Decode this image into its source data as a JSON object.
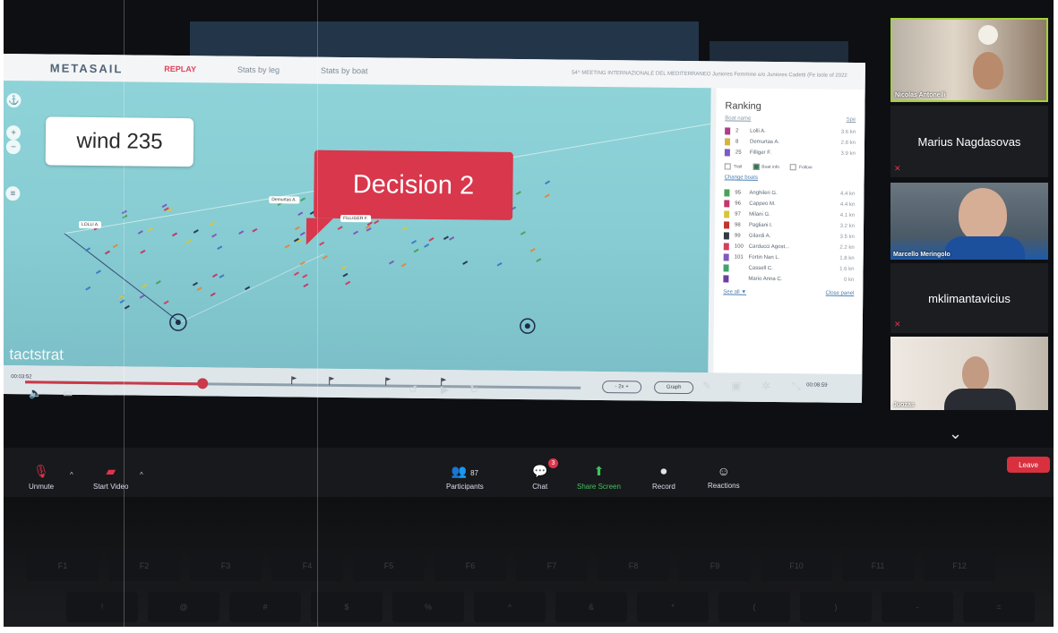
{
  "app": {
    "logo": "METASAIL",
    "tabs": [
      "REPLAY",
      "Stats by leg",
      "Stats by boat"
    ],
    "active_tab": "REPLAY",
    "event_title": "54^ MEETING INTERNAZIONALE DEL MEDITERRANEO Juniores Femmine e/o Juniores Cadetti (Fe isole of 2022"
  },
  "map": {
    "wind_label": "wind 235",
    "callout": "Decision 2",
    "watermark": "tactstrat",
    "boat_tags": [
      "LOLLI A.",
      "Demurtas A.",
      "FILLIGER F."
    ]
  },
  "ranking": {
    "title": "Ranking",
    "header_left": "Boat name",
    "header_right": "Spe",
    "top": [
      {
        "pos": "2",
        "name": "Lolli A.",
        "speed": "3.6 kn",
        "color": "#b03a8c"
      },
      {
        "pos": "8",
        "name": "Demurtas A.",
        "speed": "2.8 kn",
        "color": "#d9b23c"
      },
      {
        "pos": "25",
        "name": "Filliger F.",
        "speed": "3.9 kn",
        "color": "#7a5cc4"
      }
    ],
    "checks": [
      {
        "label": "Trail",
        "on": false
      },
      {
        "label": "Boat info",
        "on": true
      },
      {
        "label": "Follow",
        "on": false
      }
    ],
    "change_link": "Change boats",
    "rest": [
      {
        "pos": "95",
        "name": "Anghileri G.",
        "speed": "4.4 kn",
        "color": "#4aa35a"
      },
      {
        "pos": "96",
        "name": "Cappeo M.",
        "speed": "4.4 kn",
        "color": "#c0396b"
      },
      {
        "pos": "97",
        "name": "Milani G.",
        "speed": "4.1 kn",
        "color": "#d7c53e"
      },
      {
        "pos": "98",
        "name": "Pagliani I.",
        "speed": "3.2 kn",
        "color": "#c2352f"
      },
      {
        "pos": "99",
        "name": "Gilardi A.",
        "speed": "3.5 kn",
        "color": "#333a44"
      },
      {
        "pos": "100",
        "name": "Carducci Agost...",
        "speed": "2.2 kn",
        "color": "#d2405f"
      },
      {
        "pos": "101",
        "name": "Fortin Nan L.",
        "speed": "1.8 kn",
        "color": "#7e5bbd"
      },
      {
        "pos": "",
        "name": "Cassell C.",
        "speed": "1.6 kn",
        "color": "#3fa36f"
      },
      {
        "pos": "",
        "name": "Mario Anna C.",
        "speed": "0 kn",
        "color": "#6c3ea0"
      }
    ],
    "footer_left": "See all ▼",
    "footer_right": "Close panel"
  },
  "timeline": {
    "current": "00:03:52",
    "total": "00:08:59",
    "speed": "- 2x +",
    "graph_btn": "Graph",
    "progress": 0.32
  },
  "participants": [
    {
      "name": "Nicolas Antonelli",
      "video": true
    },
    {
      "name": "Marius Nagdasovas",
      "video": false
    },
    {
      "name": "Marcello Meringolo",
      "video": true
    },
    {
      "name": "mklimantavicius",
      "video": false
    },
    {
      "name": "Juozas",
      "video": true
    }
  ],
  "toolbar": {
    "unmute": "Unmute",
    "start_video": "Start Video",
    "participants": "Participants",
    "participant_count": "87",
    "chat": "Chat",
    "chat_badge": "3",
    "share_screen": "Share Screen",
    "record": "Record",
    "reactions": "Reactions",
    "leave": "Leave"
  },
  "keyboard": {
    "fkeys": [
      "F1",
      "F2",
      "F3",
      "F4",
      "F5",
      "F6",
      "F7",
      "F8",
      "F9",
      "F10",
      "F11",
      "F12"
    ],
    "numrow": [
      "!",
      "@",
      "#",
      "$",
      "%",
      "^",
      "&",
      "*",
      "(",
      ")",
      "-",
      "="
    ]
  },
  "colors": {
    "accent_red": "#d8374c",
    "sea": "#8ed3d8",
    "zoom_bg": "#18191c",
    "share_green": "#41c15c"
  }
}
